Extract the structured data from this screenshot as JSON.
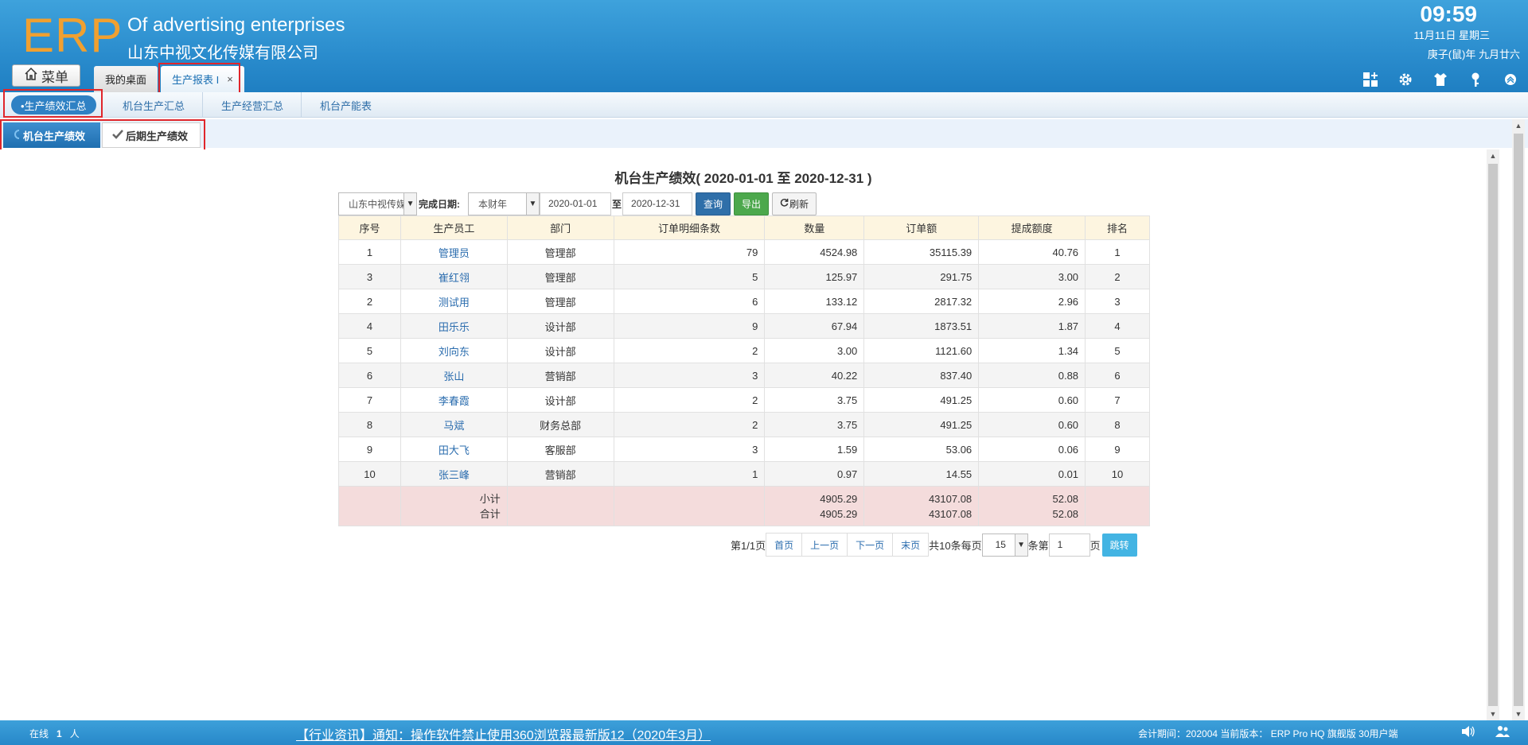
{
  "header": {
    "logo": "ERP",
    "company_en": "Of advertising enterprises",
    "company_cn": "山东中视文化传媒有限公司",
    "time": "09:59",
    "date": "11月11日 星期三",
    "lunar": "庚子(鼠)年 九月廿六",
    "menu_label": "菜单",
    "tabs": [
      {
        "label": "我的桌面"
      },
      {
        "label": "生产报表 I",
        "close": "×"
      }
    ],
    "icons": [
      "grid-plus-icon",
      "gear-icon",
      "shirt-icon",
      "key-icon",
      "collapse-up-icon"
    ]
  },
  "subnav": {
    "items": [
      {
        "label": "•生产绩效汇总"
      },
      {
        "label": "机台生产汇总"
      },
      {
        "label": "生产经营汇总"
      },
      {
        "label": "机台产能表"
      }
    ]
  },
  "subtabs": {
    "items": [
      {
        "label": "机台生产绩效",
        "icon": "spinner-icon"
      },
      {
        "label": "后期生产绩效",
        "icon": "check-icon"
      }
    ]
  },
  "report": {
    "title": "机台生产绩效( 2020-01-01 至 2020-12-31 )",
    "company_select": "山东中视传媒",
    "date_label": "完成日期:",
    "period_select": "本财年",
    "date_from": "2020-01-01",
    "to_label": "至",
    "date_to": "2020-12-31",
    "btn_query": "查询",
    "btn_export": "导出",
    "btn_refresh": "刷新",
    "columns": [
      "序号",
      "生产员工",
      "部门",
      "订单明细条数",
      "数量",
      "订单额",
      "提成额度",
      "排名"
    ],
    "rows": [
      [
        "1",
        "管理员",
        "管理部",
        "79",
        "4524.98",
        "35115.39",
        "40.76",
        "1"
      ],
      [
        "3",
        "崔红翎",
        "管理部",
        "5",
        "125.97",
        "291.75",
        "3.00",
        "2"
      ],
      [
        "2",
        "测试用",
        "管理部",
        "6",
        "133.12",
        "2817.32",
        "2.96",
        "3"
      ],
      [
        "4",
        "田乐乐",
        "设计部",
        "9",
        "67.94",
        "1873.51",
        "1.87",
        "4"
      ],
      [
        "5",
        "刘向东",
        "设计部",
        "2",
        "3.00",
        "1121.60",
        "1.34",
        "5"
      ],
      [
        "6",
        "张山",
        "营销部",
        "3",
        "40.22",
        "837.40",
        "0.88",
        "6"
      ],
      [
        "7",
        "李春霞",
        "设计部",
        "2",
        "3.75",
        "491.25",
        "0.60",
        "7"
      ],
      [
        "8",
        "马斌",
        "财务总部",
        "2",
        "3.75",
        "491.25",
        "0.60",
        "8"
      ],
      [
        "9",
        "田大飞",
        "客服部",
        "3",
        "1.59",
        "53.06",
        "0.06",
        "9"
      ],
      [
        "10",
        "张三峰",
        "营销部",
        "1",
        "0.97",
        "14.55",
        "0.01",
        "10"
      ]
    ],
    "subtotal": {
      "label": "小计",
      "qty": "4905.29",
      "amount": "43107.08",
      "commission": "52.08"
    },
    "total": {
      "label": "合计",
      "qty": "4905.29",
      "amount": "43107.08",
      "commission": "52.08"
    },
    "pager": {
      "page_info": "第1/1页",
      "first": "首页",
      "prev": "上一页",
      "next": "下一页",
      "last": "末页",
      "count_info": "共10条每页",
      "page_size": "15",
      "unit_info": "条第",
      "goto_value": "1",
      "page_unit": "页",
      "go": "跳转"
    }
  },
  "footer": {
    "online_label": "在线",
    "online_count": "1",
    "online_unit": "人",
    "news": "【行业资讯】通知：操作软件禁止使用360浏览器最新版12（2020年3月）",
    "period": "会计期间：202004 当前版本： ERP Pro HQ 旗舰版 30用户端"
  },
  "colors": {
    "header_blue": "#2a8ccd",
    "logo_orange": "#f0a030",
    "highlight_red": "#e0262b",
    "link_blue": "#2a6cae",
    "summary_pink": "#f4dcdc"
  }
}
